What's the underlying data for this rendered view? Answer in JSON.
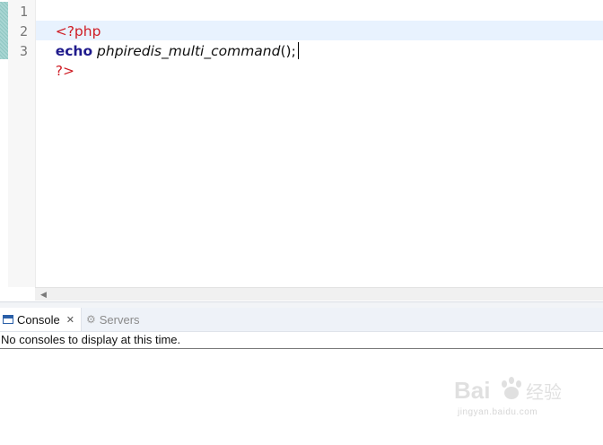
{
  "editor": {
    "line_numbers": [
      "1",
      "2",
      "3"
    ],
    "lines": {
      "l1": {
        "open_tag": "<?php"
      },
      "l2": {
        "keyword": "echo",
        "space": " ",
        "function": "phpiredis_multi_command",
        "parens": "();"
      },
      "l3": {
        "close_tag": "?>"
      }
    }
  },
  "panel": {
    "tabs": {
      "console": {
        "label": "Console",
        "close": "✕"
      },
      "servers": {
        "label": "Servers"
      }
    },
    "message": "No consoles to display at this time."
  },
  "watermark": {
    "url": "jingyan.baidu.com",
    "brand": "Bai",
    "brand2": "经验"
  },
  "colors": {
    "php_tag": "#cf1d25",
    "keyword": "#1f1a8c",
    "current_line": "#e8f2fe"
  }
}
